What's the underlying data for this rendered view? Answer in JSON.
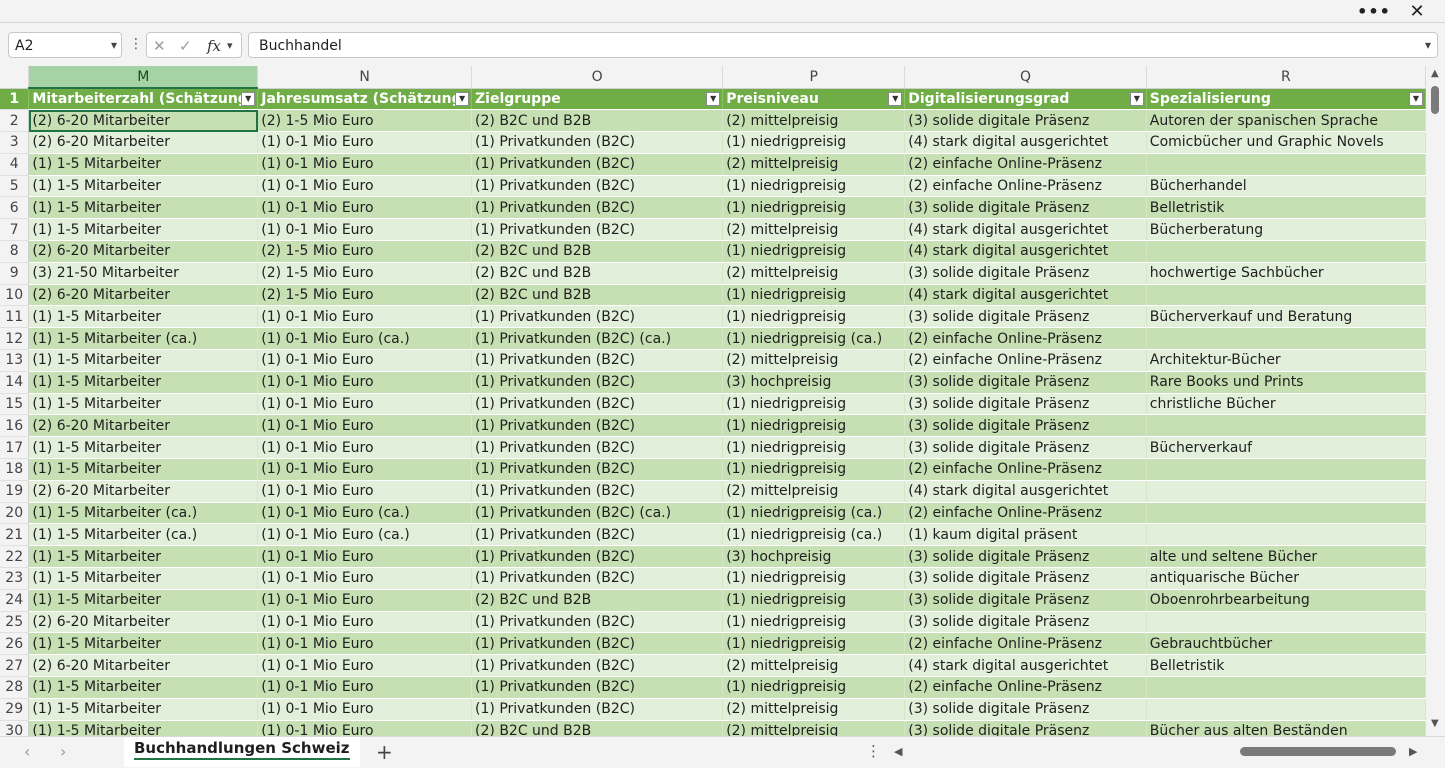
{
  "window": {
    "more_icon": "more-icon",
    "close_icon": "close-icon"
  },
  "formula_bar": {
    "name_box": "A2",
    "formula": "Buchhandel"
  },
  "grid": {
    "columns": [
      {
        "letter": "M",
        "selected": true
      },
      {
        "letter": "N",
        "selected": false
      },
      {
        "letter": "O",
        "selected": false
      },
      {
        "letter": "P",
        "selected": false
      },
      {
        "letter": "Q",
        "selected": false
      },
      {
        "letter": "R",
        "selected": false
      }
    ],
    "headers": [
      "Mitarbeiterzahl (Schätzung)",
      "Jahresumsatz (Schätzung)",
      "Zielgruppe",
      "Preisniveau",
      "Digitalisierungsgrad",
      "Spezialisierung"
    ],
    "rows": [
      {
        "n": 2,
        "cells": [
          "(2) 6-20 Mitarbeiter",
          "(2) 1-5 Mio Euro",
          "(2) B2C und B2B",
          "(2) mittelpreisig",
          "(3) solide digitale Präsenz",
          "Autoren der spanischen Sprache"
        ]
      },
      {
        "n": 3,
        "cells": [
          "(2) 6-20 Mitarbeiter",
          "(1) 0-1 Mio Euro",
          "(1) Privatkunden (B2C)",
          "(1) niedrigpreisig",
          "(4) stark digital ausgerichtet",
          "Comicbücher und Graphic Novels"
        ]
      },
      {
        "n": 4,
        "cells": [
          "(1) 1-5 Mitarbeiter",
          "(1) 0-1 Mio Euro",
          "(1) Privatkunden (B2C)",
          "(2) mittelpreisig",
          "(2) einfache Online-Präsenz",
          ""
        ]
      },
      {
        "n": 5,
        "cells": [
          "(1) 1-5 Mitarbeiter",
          "(1) 0-1 Mio Euro",
          "(1) Privatkunden (B2C)",
          "(1) niedrigpreisig",
          "(2) einfache Online-Präsenz",
          "Bücherhandel"
        ]
      },
      {
        "n": 6,
        "cells": [
          "(1) 1-5 Mitarbeiter",
          "(1) 0-1 Mio Euro",
          "(1) Privatkunden (B2C)",
          "(1) niedrigpreisig",
          "(3) solide digitale Präsenz",
          "Belletristik"
        ]
      },
      {
        "n": 7,
        "cells": [
          "(1) 1-5 Mitarbeiter",
          "(1) 0-1 Mio Euro",
          "(1) Privatkunden (B2C)",
          "(2) mittelpreisig",
          "(4) stark digital ausgerichtet",
          "Bücherberatung"
        ]
      },
      {
        "n": 8,
        "cells": [
          "(2) 6-20 Mitarbeiter",
          "(2) 1-5 Mio Euro",
          "(2) B2C und B2B",
          "(1) niedrigpreisig",
          "(4) stark digital ausgerichtet",
          ""
        ]
      },
      {
        "n": 9,
        "cells": [
          "(3) 21-50 Mitarbeiter",
          "(2) 1-5 Mio Euro",
          "(2) B2C und B2B",
          "(2) mittelpreisig",
          "(3) solide digitale Präsenz",
          "hochwertige Sachbücher"
        ]
      },
      {
        "n": 10,
        "cells": [
          "(2) 6-20 Mitarbeiter",
          "(2) 1-5 Mio Euro",
          "(2) B2C und B2B",
          "(1) niedrigpreisig",
          "(4) stark digital ausgerichtet",
          ""
        ]
      },
      {
        "n": 11,
        "cells": [
          "(1) 1-5 Mitarbeiter",
          "(1) 0-1 Mio Euro",
          "(1) Privatkunden (B2C)",
          "(1) niedrigpreisig",
          "(3) solide digitale Präsenz",
          "Bücherverkauf und Beratung"
        ]
      },
      {
        "n": 12,
        "cells": [
          "(1) 1-5 Mitarbeiter (ca.)",
          "(1) 0-1 Mio Euro (ca.)",
          "(1) Privatkunden (B2C) (ca.)",
          "(1) niedrigpreisig (ca.)",
          "(2) einfache Online-Präsenz",
          ""
        ]
      },
      {
        "n": 13,
        "cells": [
          "(1) 1-5 Mitarbeiter",
          "(1) 0-1 Mio Euro",
          "(1) Privatkunden (B2C)",
          "(2) mittelpreisig",
          "(2) einfache Online-Präsenz",
          "Architektur-Bücher"
        ]
      },
      {
        "n": 14,
        "cells": [
          "(1) 1-5 Mitarbeiter",
          "(1) 0-1 Mio Euro",
          "(1) Privatkunden (B2C)",
          "(3) hochpreisig",
          "(3) solide digitale Präsenz",
          "Rare Books und Prints"
        ]
      },
      {
        "n": 15,
        "cells": [
          "(1) 1-5 Mitarbeiter",
          "(1) 0-1 Mio Euro",
          "(1) Privatkunden (B2C)",
          "(1) niedrigpreisig",
          "(3) solide digitale Präsenz",
          "christliche Bücher"
        ]
      },
      {
        "n": 16,
        "cells": [
          "(2) 6-20 Mitarbeiter",
          "(1) 0-1 Mio Euro",
          "(1) Privatkunden (B2C)",
          "(1) niedrigpreisig",
          "(3) solide digitale Präsenz",
          ""
        ]
      },
      {
        "n": 17,
        "cells": [
          "(1) 1-5 Mitarbeiter",
          "(1) 0-1 Mio Euro",
          "(1) Privatkunden (B2C)",
          "(1) niedrigpreisig",
          "(3) solide digitale Präsenz",
          "Bücherverkauf"
        ]
      },
      {
        "n": 18,
        "cells": [
          "(1) 1-5 Mitarbeiter",
          "(1) 0-1 Mio Euro",
          "(1) Privatkunden (B2C)",
          "(1) niedrigpreisig",
          "(2) einfache Online-Präsenz",
          ""
        ]
      },
      {
        "n": 19,
        "cells": [
          "(2) 6-20 Mitarbeiter",
          "(1) 0-1 Mio Euro",
          "(1) Privatkunden (B2C)",
          "(2) mittelpreisig",
          "(4) stark digital ausgerichtet",
          ""
        ]
      },
      {
        "n": 20,
        "cells": [
          "(1) 1-5 Mitarbeiter (ca.)",
          "(1) 0-1 Mio Euro (ca.)",
          "(1) Privatkunden (B2C) (ca.)",
          "(1) niedrigpreisig (ca.)",
          "(2) einfache Online-Präsenz",
          ""
        ]
      },
      {
        "n": 21,
        "cells": [
          "(1) 1-5 Mitarbeiter (ca.)",
          "(1) 0-1 Mio Euro (ca.)",
          "(1) Privatkunden (B2C)",
          "(1) niedrigpreisig (ca.)",
          "(1) kaum digital präsent",
          ""
        ]
      },
      {
        "n": 22,
        "cells": [
          "(1) 1-5 Mitarbeiter",
          "(1) 0-1 Mio Euro",
          "(1) Privatkunden (B2C)",
          "(3) hochpreisig",
          "(3) solide digitale Präsenz",
          "alte und seltene Bücher"
        ]
      },
      {
        "n": 23,
        "cells": [
          "(1) 1-5 Mitarbeiter",
          "(1) 0-1 Mio Euro",
          "(1) Privatkunden (B2C)",
          "(1) niedrigpreisig",
          "(3) solide digitale Präsenz",
          "antiquarische Bücher"
        ]
      },
      {
        "n": 24,
        "cells": [
          "(1) 1-5 Mitarbeiter",
          "(1) 0-1 Mio Euro",
          "(2) B2C und B2B",
          "(1) niedrigpreisig",
          "(3) solide digitale Präsenz",
          "Oboenrohrbearbeitung"
        ]
      },
      {
        "n": 25,
        "cells": [
          "(2) 6-20 Mitarbeiter",
          "(1) 0-1 Mio Euro",
          "(1) Privatkunden (B2C)",
          "(1) niedrigpreisig",
          "(3) solide digitale Präsenz",
          ""
        ]
      },
      {
        "n": 26,
        "cells": [
          "(1) 1-5 Mitarbeiter",
          "(1) 0-1 Mio Euro",
          "(1) Privatkunden (B2C)",
          "(1) niedrigpreisig",
          "(2) einfache Online-Präsenz",
          "Gebrauchtbücher"
        ]
      },
      {
        "n": 27,
        "cells": [
          "(2) 6-20 Mitarbeiter",
          "(1) 0-1 Mio Euro",
          "(1) Privatkunden (B2C)",
          "(2) mittelpreisig",
          "(4) stark digital ausgerichtet",
          "Belletristik"
        ]
      },
      {
        "n": 28,
        "cells": [
          "(1) 1-5 Mitarbeiter",
          "(1) 0-1 Mio Euro",
          "(1) Privatkunden (B2C)",
          "(1) niedrigpreisig",
          "(2) einfache Online-Präsenz",
          ""
        ]
      },
      {
        "n": 29,
        "cells": [
          "(1) 1-5 Mitarbeiter",
          "(1) 0-1 Mio Euro",
          "(1) Privatkunden (B2C)",
          "(2) mittelpreisig",
          "(3) solide digitale Präsenz",
          ""
        ]
      },
      {
        "n": 30,
        "cells": [
          "(1) 1-5 Mitarbeiter",
          "(1) 0-1 Mio Euro",
          "(2) B2C und B2B",
          "(2) mittelpreisig",
          "(3) solide digitale Präsenz",
          "Bücher aus alten Beständen"
        ]
      }
    ]
  },
  "sheets": {
    "tabs": [
      {
        "name": "Buchhandlungen Schweiz",
        "active": true
      }
    ]
  },
  "colors": {
    "header_green": "#70ad47",
    "band_dark": "#c6e0b4",
    "band_light": "#e2efda",
    "accent": "#217346"
  }
}
